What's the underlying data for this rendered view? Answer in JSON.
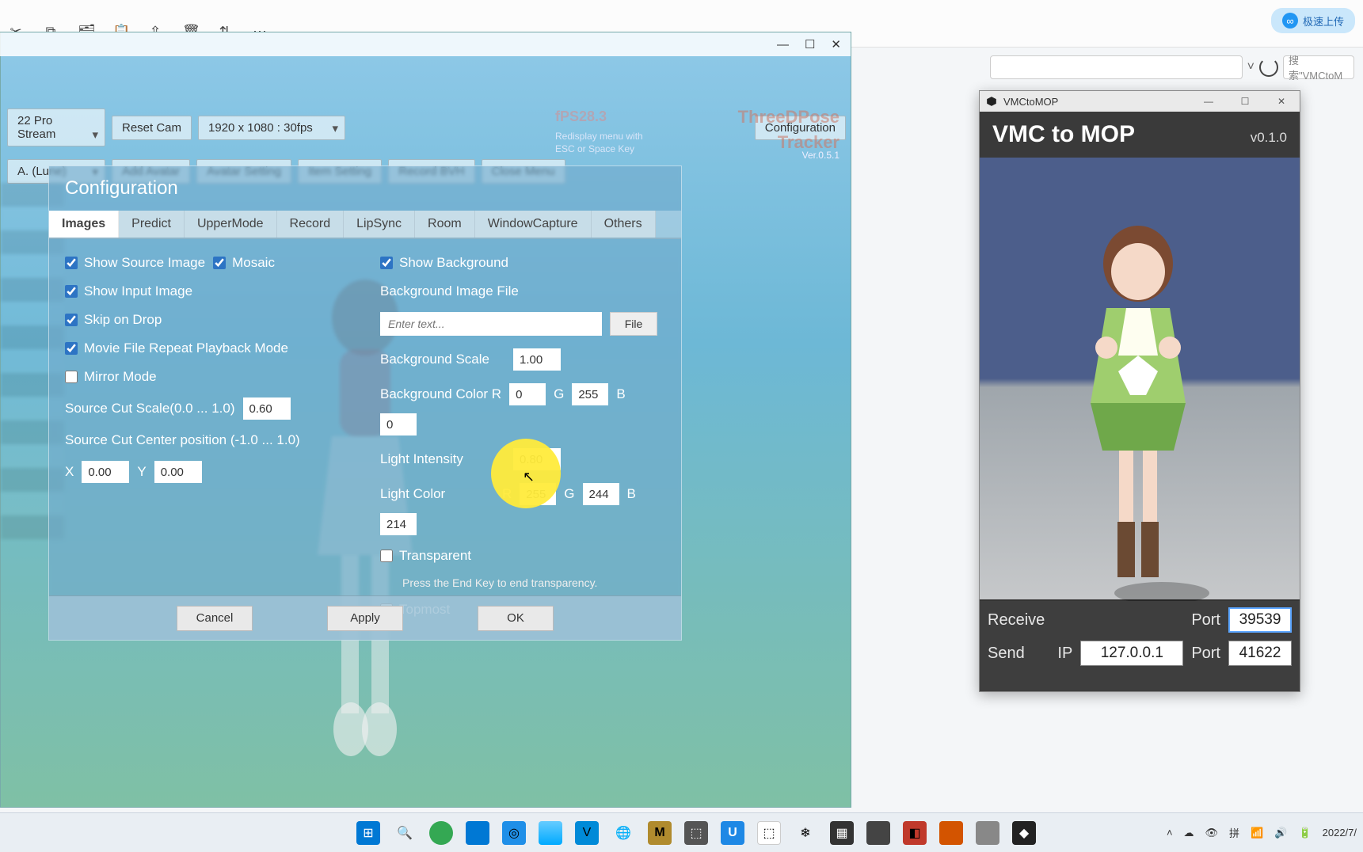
{
  "browser": {
    "upload_label": "极速上传",
    "search_placeholder": "搜索\"VMCtoM"
  },
  "tdp": {
    "window_controls": {
      "min": "—",
      "max": "☐",
      "close": "✕"
    },
    "toolbar": {
      "camera_sel": "22 Pro Stream",
      "reset_cam": "Reset Cam",
      "res_sel": "1920 x 1080 : 30fps",
      "configuration": "Configuration",
      "avatar_sel": "A. (Lune)",
      "add_avatar": "Add Avatar",
      "avatar_setting": "Avatar Setting",
      "item_setting": "Item Setting",
      "record_bvh": "Record BVH",
      "close_menu": "Close Menu"
    },
    "fps": "fPS28.3",
    "redisplay": "Redisplay menu with\nESC or Space Key",
    "logo1": "ThreeDPose",
    "logo2": "Tracker",
    "version": "Ver.0.5.1",
    "cfg": {
      "title": "Configuration",
      "tabs": [
        "Images",
        "Predict",
        "UpperMode",
        "Record",
        "LipSync",
        "Room",
        "WindowCapture",
        "Others"
      ],
      "show_source": "Show Source Image",
      "mosaic": "Mosaic",
      "show_input": "Show Input Image",
      "skip_drop": "Skip on Drop",
      "movie_repeat": "Movie File Repeat Playback Mode",
      "mirror": "Mirror Mode",
      "src_cut_scale_label": "Source Cut Scale(0.0 ... 1.0)",
      "src_cut_scale": "0.60",
      "src_cut_center_label": "Source Cut Center position (-1.0 ... 1.0)",
      "x_label": "X",
      "x_val": "0.00",
      "y_label": "Y",
      "y_val": "0.00",
      "show_bg": "Show Background",
      "bg_file_label": "Background Image  File",
      "bg_file_placeholder": "Enter text...",
      "file_btn": "File",
      "bg_scale_label": "Background Scale",
      "bg_scale": "1.00",
      "bg_color_label": "Background Color R",
      "bg_r": "0",
      "g_label": "G",
      "bg_g": "255",
      "b_label": "B",
      "bg_b": "0",
      "light_int_label": "Light Intensity",
      "light_int": "0.80",
      "light_color_label": "Light Color",
      "r_label": "R",
      "lc_r": "255",
      "lc_g": "244",
      "lc_b": "214",
      "transparent": "Transparent",
      "transparent_note": "Press the End Key to end transparency.",
      "topmost": "Topmost",
      "cancel": "Cancel",
      "apply": "Apply",
      "ok": "OK"
    }
  },
  "vmc": {
    "title": "VMCtoMOP",
    "header": "VMC to MOP",
    "version": "v0.1.0",
    "receive": "Receive",
    "port_label": "Port",
    "receive_port": "39539",
    "send": "Send",
    "ip_label": "IP",
    "ip": "127.0.0.1",
    "send_port": "41622"
  },
  "taskbar": {
    "date": "2022/7/"
  }
}
